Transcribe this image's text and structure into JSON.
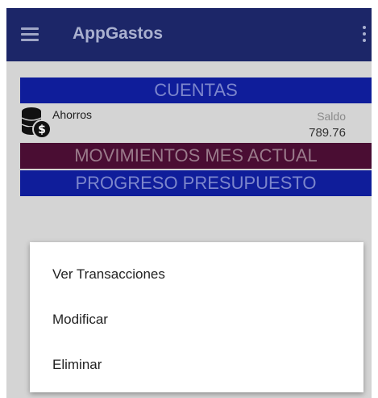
{
  "appbar": {
    "title": "AppGastos",
    "menu_icon": "hamburger-icon",
    "overflow_icon": "more-vert-icon"
  },
  "sections": {
    "cuentas": "CUENTAS",
    "movimientos": "MOVIMIENTOS MES ACTUAL",
    "progreso": "PROGRESO PRESUPUESTO"
  },
  "account": {
    "icon": "coins-icon",
    "name": "Ahorros",
    "saldo_label": "Saldo",
    "saldo_value": "789.76"
  },
  "context_menu": {
    "items": [
      {
        "label": "Ver Transacciones"
      },
      {
        "label": "Modificar"
      },
      {
        "label": "Eliminar"
      }
    ]
  },
  "colors": {
    "appbar": "#1c2668",
    "section_blue": "#0f1d9a",
    "section_maroon": "#4a0d33",
    "scrim": "#d4d4d4"
  }
}
